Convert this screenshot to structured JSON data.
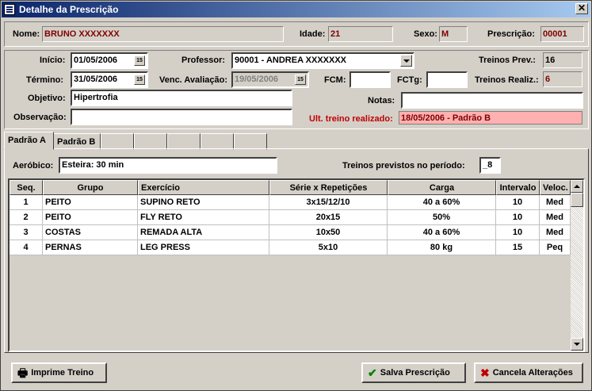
{
  "window": {
    "title": "Detalhe da Prescrição",
    "close_glyph": "✕",
    "title_icon": "app-icon"
  },
  "header": {
    "nome_label": "Nome:",
    "nome_value": "BRUNO XXXXXXX",
    "idade_label": "Idade:",
    "idade_value": "21",
    "sexo_label": "Sexo:",
    "sexo_value": "M",
    "prescricao_label": "Prescrição:",
    "prescricao_value": "00001"
  },
  "form": {
    "inicio_label": "Início:",
    "inicio_value": "01/05/2006",
    "termino_label": "Término:",
    "termino_value": "31/05/2006",
    "objetivo_label": "Objetivo:",
    "objetivo_value": "Hipertrofia",
    "observacao_label": "Observação:",
    "observacao_value": "",
    "professor_label": "Professor:",
    "professor_value": "90001 - ANDREA XXXXXXX",
    "venc_label": "Venc. Avaliação:",
    "venc_value": "19/05/2006",
    "fcm_label": "FCM:",
    "fcm_value": "",
    "fctg_label": "FCTg:",
    "fctg_value": "",
    "notas_label": "Notas:",
    "notas_value": "",
    "treinos_prev_label": "Treinos Prev.:",
    "treinos_prev_value": "16",
    "treinos_realiz_label": "Treinos Realiz.:",
    "treinos_realiz_value": "6",
    "ult_treino_label": "Ult. treino realizado:",
    "ult_treino_value": "18/05/2006 - Padrão B",
    "cal_glyph": "15"
  },
  "tabs": [
    {
      "label": "Padrão A"
    },
    {
      "label": "Padrão B"
    }
  ],
  "padrao": {
    "aerobico_label": "Aeróbico:",
    "aerobico_value": "Esteira: 30 min",
    "treinos_previstos_label": "Treinos previstos no período:",
    "treinos_previstos_value": "_8"
  },
  "table": {
    "headers": [
      "Seq.",
      "Grupo",
      "Exercício",
      "Série x Repetições",
      "Carga",
      "Intervalo",
      "Veloc."
    ],
    "rows": [
      [
        "1",
        "PEITO",
        "SUPINO RETO",
        "3x15/12/10",
        "40 a 60%",
        "10",
        "Med"
      ],
      [
        "2",
        "PEITO",
        "FLY RETO",
        "20x15",
        "50%",
        "10",
        "Med"
      ],
      [
        "3",
        "COSTAS",
        "REMADA ALTA",
        "10x50",
        "40 a 60%",
        "10",
        "Med"
      ],
      [
        "4",
        "PERNAS",
        "LEG PRESS",
        "5x10",
        "80 kg",
        "15",
        "Peq"
      ]
    ]
  },
  "buttons": {
    "imprime": "Imprime Treino",
    "salva": "Salva Prescrição",
    "cancela": "Cancela Alterações"
  }
}
